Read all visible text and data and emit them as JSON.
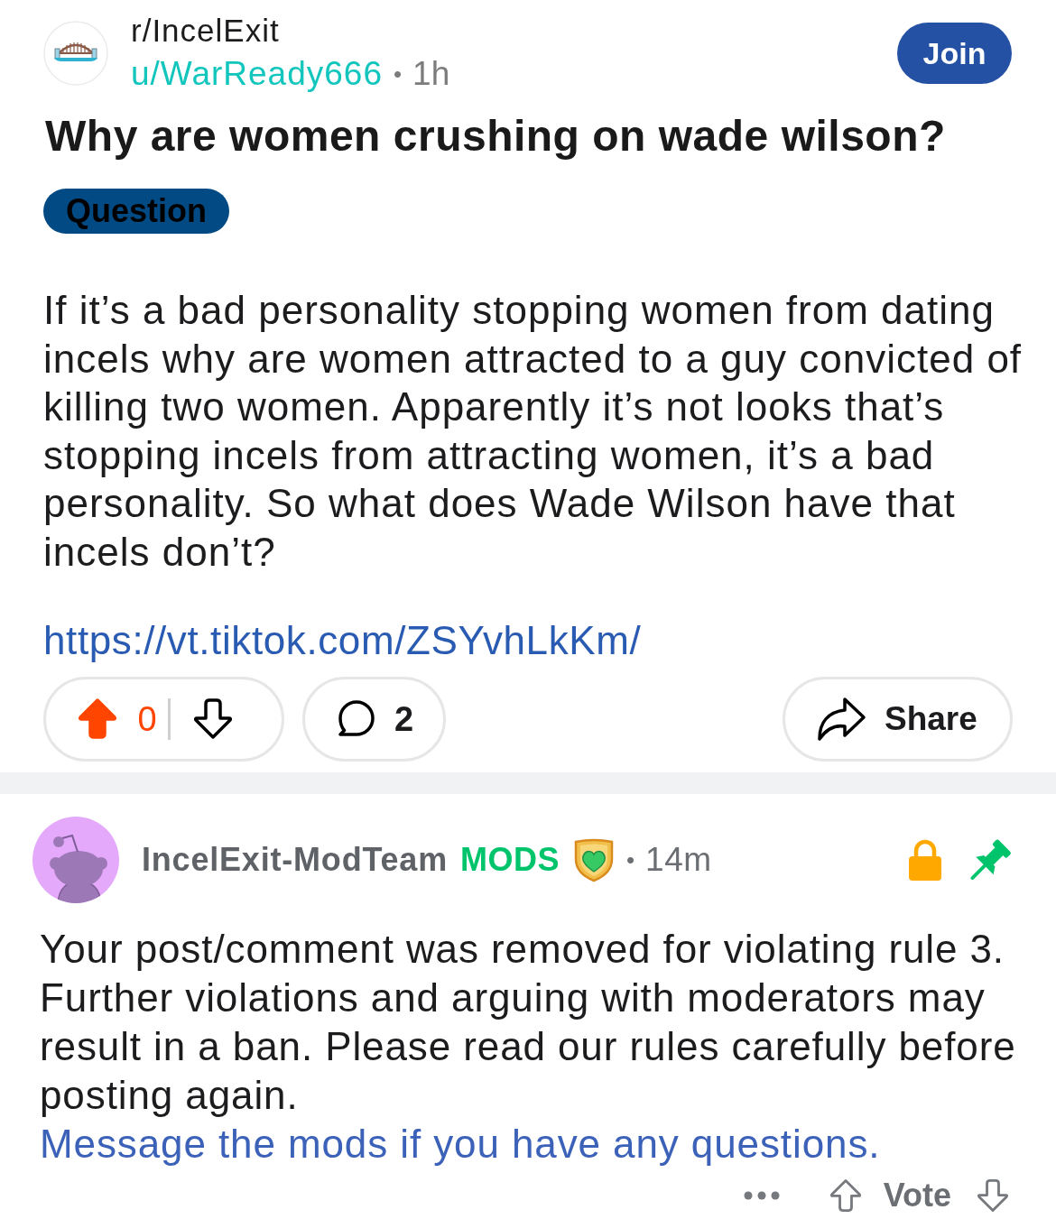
{
  "post": {
    "community": "r/IncelExit",
    "author": "u/WarReady666",
    "separator": "•",
    "age": "1h",
    "join_label": "Join",
    "title": "Why are women crushing on wade wilson?",
    "flair": "Question",
    "body": "If it’s a bad personality stopping women from dating incels why are women attracted to a guy convicted of killing two women. Apparently it’s not looks that’s stopping incels from attracting women, it’s a bad personality. So what does Wade Wilson have that incels don’t?",
    "link": "https://vt.tiktok.com/ZSYvhLkKm/",
    "upvoted": true,
    "downvoted": false,
    "score": "0",
    "comment_count": "2",
    "share_label": "Share"
  },
  "comment": {
    "author": "IncelExit-ModTeam",
    "role_badge": "MODS",
    "separator": "•",
    "age": "14m",
    "locked": true,
    "pinned": true,
    "body": "Your post/comment was removed for violating rule 3. Further violations and arguing with moderators may result in a ban. Please read our rules carefully before posting again.",
    "link": "Message the mods if you have any questions.",
    "vote_label": "Vote"
  }
}
